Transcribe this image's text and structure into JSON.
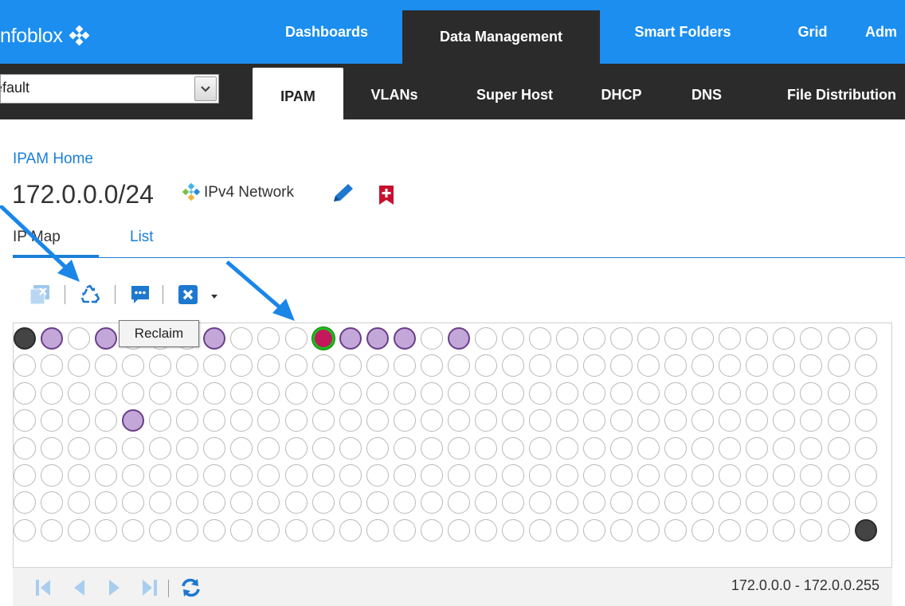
{
  "topnav": {
    "logo_text": "nfoblox",
    "tabs": [
      "Dashboards",
      "Data Management",
      "Smart Folders",
      "Grid",
      "Adm"
    ],
    "active_tab": "Data Management"
  },
  "subnav": {
    "view_value": "efault",
    "tabs": [
      "IPAM",
      "VLANs",
      "Super Host",
      "DHCP",
      "DNS",
      "File Distribution"
    ],
    "active_tab": "IPAM"
  },
  "header": {
    "breadcrumb": "IPAM Home",
    "title": "172.0.0.0/24",
    "network_type": "IPv4 Network"
  },
  "view_tabs": {
    "ipmap": "IP Map",
    "list": "List",
    "active": "IP Map"
  },
  "toolbar": {
    "icons": [
      "clear-icon",
      "reclaim-icon",
      "comment-icon",
      "delete-icon"
    ],
    "tooltip": "Reclaim"
  },
  "ipmap": {
    "columns": 32,
    "rows": 8,
    "used": [
      1,
      3,
      7,
      12,
      13,
      14,
      16,
      100
    ],
    "reserved": [
      0,
      255
    ],
    "conflict": [
      11
    ],
    "colors": {
      "used": "#c3a7d9",
      "reserved": "#444444",
      "conflict": "#c4185c",
      "conflict_ring": "#1ebb1e",
      "unused_border": "#b9b9b9"
    }
  },
  "footer": {
    "range": "172.0.0.0 - 172.0.0.255",
    "pager_icons": [
      "first-page-icon",
      "prev-page-icon",
      "next-page-icon",
      "last-page-icon",
      "refresh-icon"
    ]
  },
  "colors": {
    "brand_blue": "#1b8ef0",
    "dark_nav": "#2b2b2b",
    "link_blue": "#1a7fd8"
  }
}
